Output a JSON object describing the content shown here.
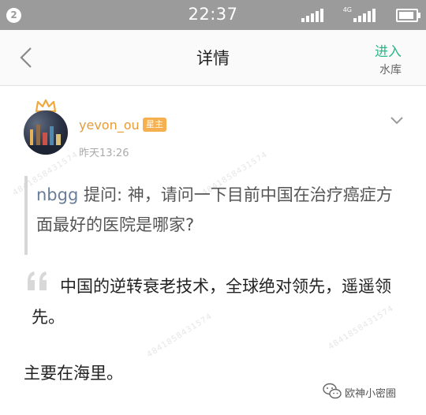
{
  "status_bar": {
    "notification_count": "2",
    "time": "22:37",
    "network": "4G"
  },
  "navbar": {
    "title": "详情",
    "enter_label": "进入",
    "enter_sub_label": "水库"
  },
  "post": {
    "username": "yevon_ou",
    "badge": "星主",
    "time": "昨天13:26",
    "quote": {
      "user": "nbgg",
      "text": "提问: 神，请问一下目前中国在治疗癌症方面最好的医院是哪家?"
    },
    "answer_line1": "中国的逆转衰老技术，全球绝对领先，遥遥领先。",
    "answer_line2": "主要在海里。"
  },
  "footer": {
    "wechat_label": "欧神小密圈"
  },
  "colors": {
    "accent": "#2ab889",
    "username": "#e69c3a",
    "badge": "#f6b04f",
    "status_bar": "#9b9b9b"
  },
  "icons": [
    "back-icon",
    "chevron-down-icon",
    "crown-icon",
    "quote-marks-icon",
    "wechat-icon",
    "signal-icon",
    "battery-icon"
  ]
}
